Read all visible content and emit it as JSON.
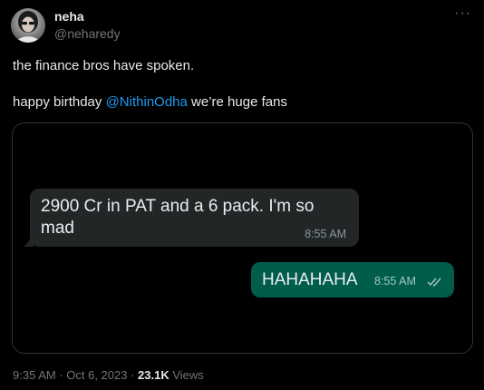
{
  "author": {
    "name": "neha",
    "handle": "@neharedy"
  },
  "tweet": {
    "line1": "the finance bros have spoken.",
    "line2_prefix": "happy birthday ",
    "mention": "@NithinOdha",
    "line2_suffix": " we’re huge fans"
  },
  "chat": {
    "incoming": {
      "text": "2900 Cr in PAT and a 6 pack. I'm so mad",
      "time": "8:55 AM"
    },
    "outgoing": {
      "text": "HAHAHAHA",
      "time": "8:55 AM"
    }
  },
  "meta": {
    "time": "9:35 AM",
    "sep1": " · ",
    "date": "Oct 6, 2023",
    "sep2": " · ",
    "views_count": "23.1K",
    "views_label": " Views"
  },
  "menu": {
    "more_label": "···"
  },
  "colors": {
    "background": "#000000",
    "link": "#1d9bf0",
    "incoming_bubble": "#232626",
    "outgoing_bubble": "#005c4b",
    "secondary_text": "#71767b"
  }
}
